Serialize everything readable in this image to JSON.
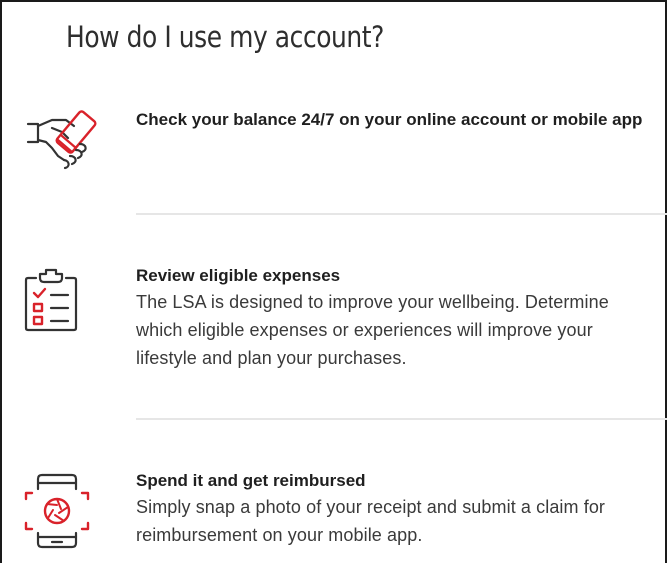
{
  "page": {
    "title": "How do I use my account?"
  },
  "items": [
    {
      "icon": "handshake-phone-icon",
      "heading": "Check your balance 24/7 on your online account or mobile app",
      "description": ""
    },
    {
      "icon": "clipboard-checklist-icon",
      "heading": "Review eligible expenses",
      "description": "The LSA is designed to improve your wellbeing. Determine which eligible expenses or experiences will improve your lifestyle and plan your purchases."
    },
    {
      "icon": "phone-camera-scan-icon",
      "heading": "Spend it and get reimbursed",
      "description": "Simply snap a photo of your receipt and submit a claim for reimbursement on your mobile app."
    }
  ],
  "colors": {
    "accent": "#d9222a",
    "icon_stroke": "#333333",
    "divider": "#e6e6e6"
  }
}
